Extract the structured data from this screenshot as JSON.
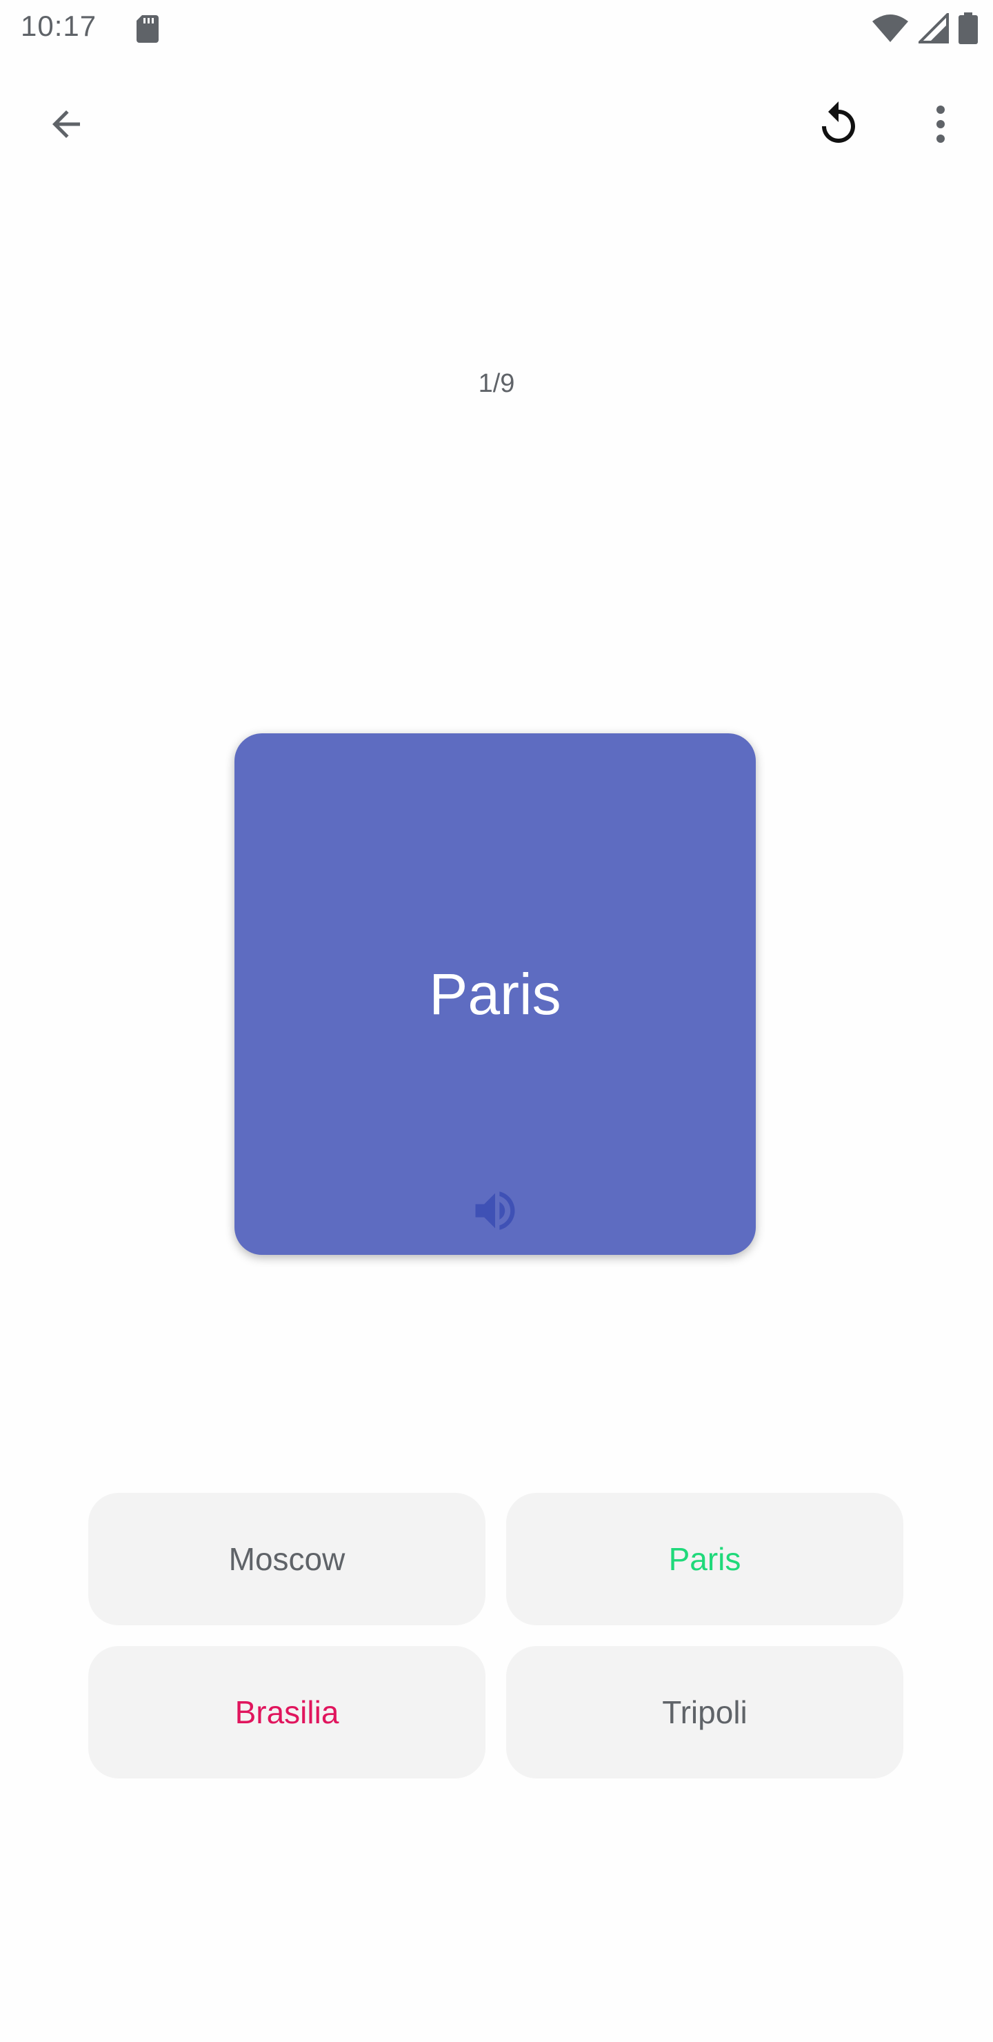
{
  "status_bar": {
    "time": "10:17",
    "icons": [
      "sd-card-icon",
      "wifi-icon",
      "signal-icon",
      "battery-icon"
    ]
  },
  "toolbar": {
    "back_icon": "arrow-back-icon",
    "restart_icon": "restart-icon",
    "more_icon": "more-vert-icon"
  },
  "quiz": {
    "counter": "1/9",
    "card_word": "Paris",
    "card_color": "#5e6cc1",
    "speaker_icon": "volume-icon"
  },
  "answers": [
    {
      "label": "Moscow",
      "state": "neutral"
    },
    {
      "label": "Paris",
      "state": "correct",
      "color": "#1fd97a"
    },
    {
      "label": "Brasilia",
      "state": "wrong",
      "color": "#e0155d"
    },
    {
      "label": "Tripoli",
      "state": "neutral"
    }
  ]
}
